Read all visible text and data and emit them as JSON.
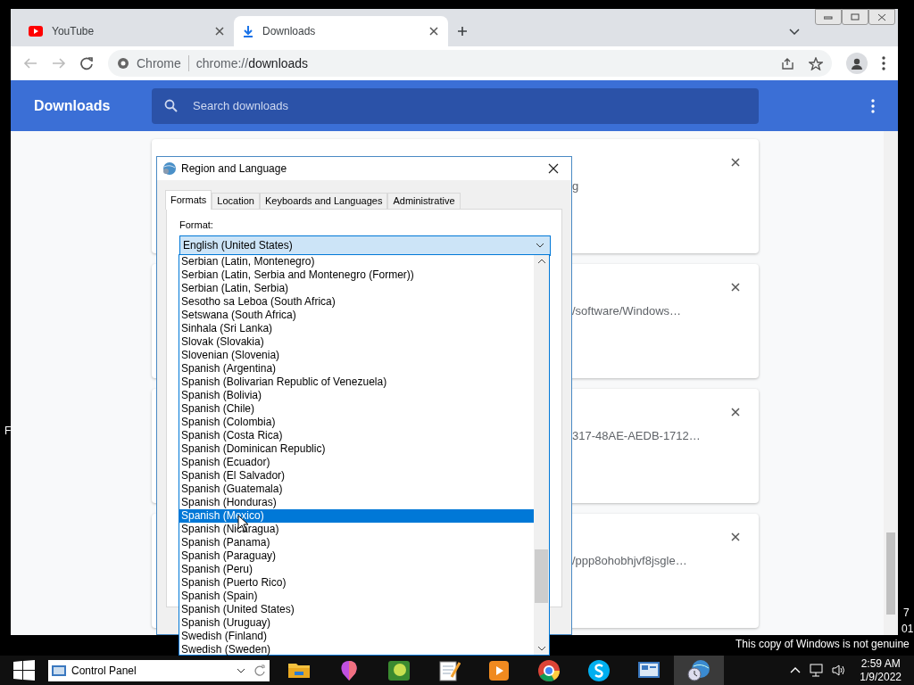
{
  "desktop_fragments": [
    "F",
    "7",
    "01"
  ],
  "browser": {
    "tabs": [
      {
        "title": "YouTube",
        "kind": "youtube",
        "selected": false
      },
      {
        "title": "Downloads",
        "kind": "download",
        "selected": true
      }
    ],
    "omnibox": {
      "site": "Chrome",
      "url_scheme": "chrome://",
      "url_path": "downloads"
    },
    "header": {
      "title": "Downloads",
      "search_placeholder": "Search downloads"
    },
    "cards": [
      {
        "text": "g"
      },
      {
        "text": "/software/Windows…"
      },
      {
        "text": "317-48AE-AEDB-1712…"
      },
      {
        "text": "/ppp8ohobhjvf8jsgle…"
      }
    ]
  },
  "dialog": {
    "title": "Region and Language",
    "tabs": [
      {
        "label": "Formats",
        "selected": true
      },
      {
        "label": "Location",
        "selected": false
      },
      {
        "label": "Keyboards and Languages",
        "selected": false
      },
      {
        "label": "Administrative",
        "selected": false
      }
    ],
    "format_label": "Format:",
    "format_value": "English (United States)",
    "options": [
      {
        "label": "Serbian (Latin, Montenegro)",
        "selected": false
      },
      {
        "label": "Serbian (Latin, Serbia and Montenegro (Former))",
        "selected": false
      },
      {
        "label": "Serbian (Latin, Serbia)",
        "selected": false
      },
      {
        "label": "Sesotho sa Leboa (South Africa)",
        "selected": false
      },
      {
        "label": "Setswana (South Africa)",
        "selected": false
      },
      {
        "label": "Sinhala (Sri Lanka)",
        "selected": false
      },
      {
        "label": "Slovak (Slovakia)",
        "selected": false
      },
      {
        "label": "Slovenian (Slovenia)",
        "selected": false
      },
      {
        "label": "Spanish (Argentina)",
        "selected": false
      },
      {
        "label": "Spanish (Bolivarian Republic of Venezuela)",
        "selected": false
      },
      {
        "label": "Spanish (Bolivia)",
        "selected": false
      },
      {
        "label": "Spanish (Chile)",
        "selected": false
      },
      {
        "label": "Spanish (Colombia)",
        "selected": false
      },
      {
        "label": "Spanish (Costa Rica)",
        "selected": false
      },
      {
        "label": "Spanish (Dominican Republic)",
        "selected": false
      },
      {
        "label": "Spanish (Ecuador)",
        "selected": false
      },
      {
        "label": "Spanish (El Salvador)",
        "selected": false
      },
      {
        "label": "Spanish (Guatemala)",
        "selected": false
      },
      {
        "label": "Spanish (Honduras)",
        "selected": false
      },
      {
        "label": "Spanish (Mexico)",
        "selected": true
      },
      {
        "label": "Spanish (Nicaragua)",
        "selected": false
      },
      {
        "label": "Spanish (Panama)",
        "selected": false
      },
      {
        "label": "Spanish (Paraguay)",
        "selected": false
      },
      {
        "label": "Spanish (Peru)",
        "selected": false
      },
      {
        "label": "Spanish (Puerto Rico)",
        "selected": false
      },
      {
        "label": "Spanish (Spain)",
        "selected": false
      },
      {
        "label": "Spanish (United States)",
        "selected": false
      },
      {
        "label": "Spanish (Uruguay)",
        "selected": false
      },
      {
        "label": "Swedish (Finland)",
        "selected": false
      },
      {
        "label": "Swedish (Sweden)",
        "selected": false
      }
    ]
  },
  "notice": "This copy of Windows is not genuine",
  "taskbar": {
    "search": "Control Panel",
    "apps": [
      {
        "kind": "folder",
        "active": false
      },
      {
        "kind": "paint",
        "active": false
      },
      {
        "kind": "game",
        "active": false
      },
      {
        "kind": "notepad",
        "active": false
      },
      {
        "kind": "player",
        "active": false
      },
      {
        "kind": "chrome",
        "active": false
      },
      {
        "kind": "skype",
        "active": false
      },
      {
        "kind": "control",
        "active": false
      },
      {
        "kind": "globe",
        "active": true
      }
    ],
    "time": "2:59 AM",
    "date": "1/9/2022"
  }
}
